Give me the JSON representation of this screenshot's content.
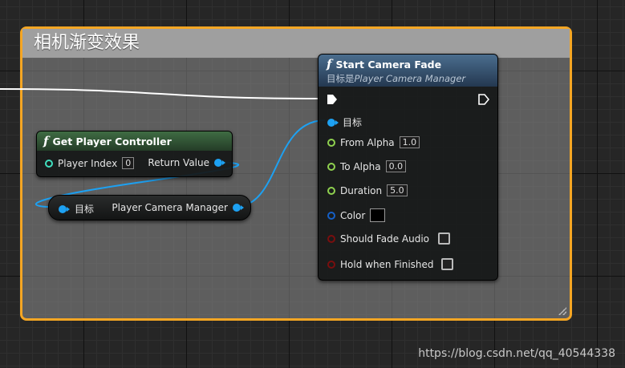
{
  "comment": {
    "title": "相机渐变效果"
  },
  "get_player_controller": {
    "title": "Get Player Controller",
    "player_index_label": "Player Index",
    "player_index_value": "0",
    "return_value_label": "Return Value"
  },
  "camera_manager_node": {
    "target_label": "目标",
    "output_label": "Player Camera Manager"
  },
  "start_camera_fade": {
    "title": "Start Camera Fade",
    "subtitle_prefix": "目标是",
    "subtitle_target": "Player Camera Manager",
    "target_label": "目标",
    "from_alpha_label": "From Alpha",
    "from_alpha_value": "1.0",
    "to_alpha_label": "To Alpha",
    "to_alpha_value": "0.0",
    "duration_label": "Duration",
    "duration_value": "5.0",
    "color_label": "Color",
    "should_fade_audio_label": "Should Fade Audio",
    "hold_when_finished_label": "Hold when Finished"
  },
  "watermark": "https://blog.csdn.net/qq_40544338",
  "colors": {
    "comment_border": "#f5a623",
    "object_pin": "#1da1f2",
    "float_pin": "#8fd14f",
    "struct_pin": "#1560c8",
    "bool_pin": "#7a0e0e",
    "int_pin": "#40e0c0"
  }
}
